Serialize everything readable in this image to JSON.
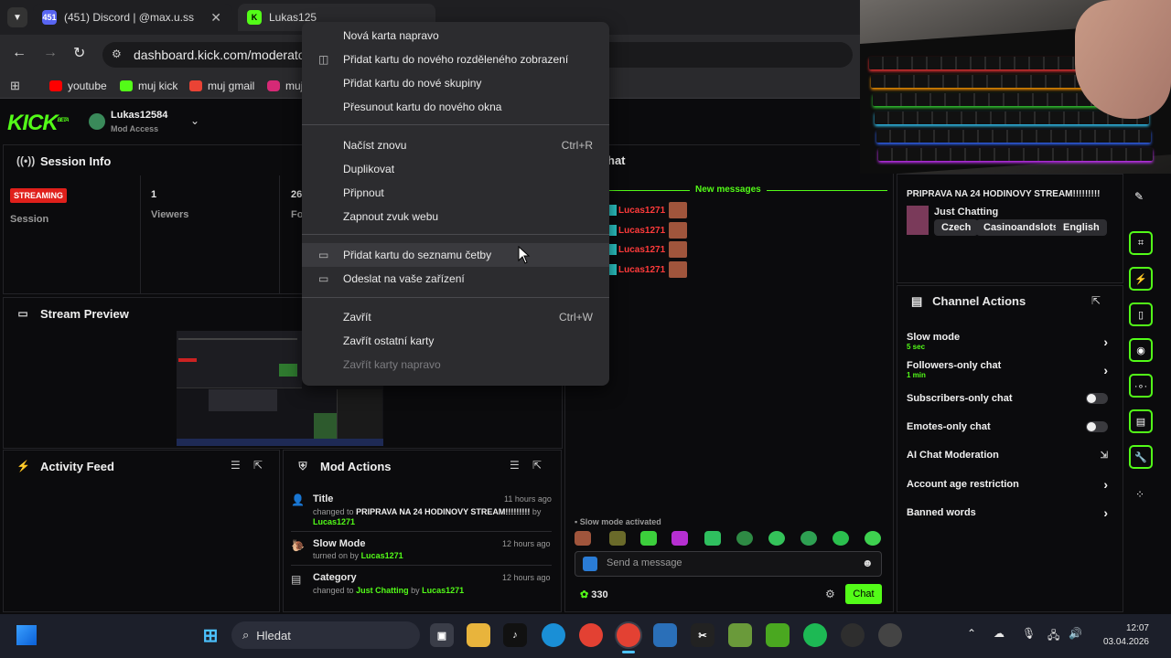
{
  "tabs": [
    {
      "label": "(451) Discord | @max.u.ss",
      "favicon": "discord-icon",
      "badge": "451"
    },
    {
      "label": "Lukas125",
      "favicon": "kick-icon",
      "badge": "K"
    }
  ],
  "address_bar": {
    "url": "dashboard.kick.com/moderator/"
  },
  "bookmarks": [
    {
      "label": "youtube",
      "icon": "youtube-icon",
      "color": "#ff0000"
    },
    {
      "label": "muj kick",
      "icon": "kick-icon",
      "color": "#53fc18"
    },
    {
      "label": "muj gmail",
      "icon": "gmail-icon",
      "color": "#ea4335"
    },
    {
      "label": "muj",
      "icon": "instagram-icon",
      "color": "#d62976"
    }
  ],
  "kick": {
    "logo": "KICK",
    "logo_sup": "BETA",
    "user": {
      "name": "Lukas12584",
      "role": "Mod Access"
    }
  },
  "session_info": {
    "title": "Session Info",
    "status_badge": "STREAMING",
    "session_label": "Session",
    "viewers_value": "1",
    "viewers_label": "Viewers",
    "followers_value": "26",
    "followers_label": "Fo"
  },
  "stream_preview": {
    "title": "Stream Preview"
  },
  "activity_feed": {
    "title": "Activity Feed"
  },
  "mod_actions": {
    "title": "Mod Actions",
    "items": [
      {
        "title": "Title",
        "time": "11 hours ago",
        "pre": "changed to",
        "value": "PRIPRAVA NA 24 HODINOVY STREAM!!!!!!!!!",
        "by": "by",
        "user": "Lucas1271",
        "icon": "person-icon"
      },
      {
        "title": "Slow Mode",
        "time": "12 hours ago",
        "pre": "turned on by",
        "value": "",
        "by": "",
        "user": "Lucas1271",
        "icon": "snail-icon"
      },
      {
        "title": "Category",
        "time": "12 hours ago",
        "pre": "changed to",
        "value": "Just Chatting",
        "by": "by",
        "user": "Lucas1271",
        "icon": "category-icon"
      }
    ]
  },
  "chat": {
    "title_fragment": "hat",
    "new_messages": "New messages",
    "messages": [
      "Lucas1271",
      "Lucas1271",
      "Lucas1271",
      "Lucas1271"
    ],
    "slow_mode_notice": "Slow mode activated",
    "input_placeholder": "Send a message",
    "points": "330",
    "send_label": "Chat"
  },
  "stream_info": {
    "title": "PRIPRAVA NA 24 HODINOVY STREAM!!!!!!!!!",
    "category": "Just Chatting",
    "tags": [
      "Czech",
      "Casinoandslots",
      "English"
    ]
  },
  "channel_actions": {
    "title": "Channel Actions",
    "slow_mode": {
      "label": "Slow mode",
      "value": "5 sec"
    },
    "followers_only": {
      "label": "Followers-only chat",
      "value": "1 min"
    },
    "subscribers_only": {
      "label": "Subscribers-only chat"
    },
    "emotes_only": {
      "label": "Emotes-only chat"
    },
    "ai_moderation": {
      "label": "AI Chat Moderation"
    },
    "account_age": {
      "label": "Account age restriction"
    },
    "banned_words": {
      "label": "Banned words"
    }
  },
  "context_menu": {
    "new_tab_right": "Nová karta napravo",
    "split_view": "Přidat kartu do nového rozděleného zobrazení",
    "new_group": "Přidat kartu do nové skupiny",
    "new_window": "Přesunout kartu do nového okna",
    "reload": "Načíst znovu",
    "reload_shortcut": "Ctrl+R",
    "duplicate": "Duplikovat",
    "pin": "Připnout",
    "unmute": "Zapnout zvuk webu",
    "reading_list": "Přidat kartu do seznamu četby",
    "send_device": "Odeslat na vaše zařízení",
    "close": "Zavřít",
    "close_shortcut": "Ctrl+W",
    "close_others": "Zavřít ostatní karty",
    "close_right": "Zavřít karty napravo"
  },
  "taskbar": {
    "search_label": "Hledat",
    "time": "12:07",
    "date": "03.04.2026"
  },
  "colors": {
    "accent": "#53fc18",
    "streaming": "#e0201b",
    "menu_bg": "#2c2c2f"
  }
}
